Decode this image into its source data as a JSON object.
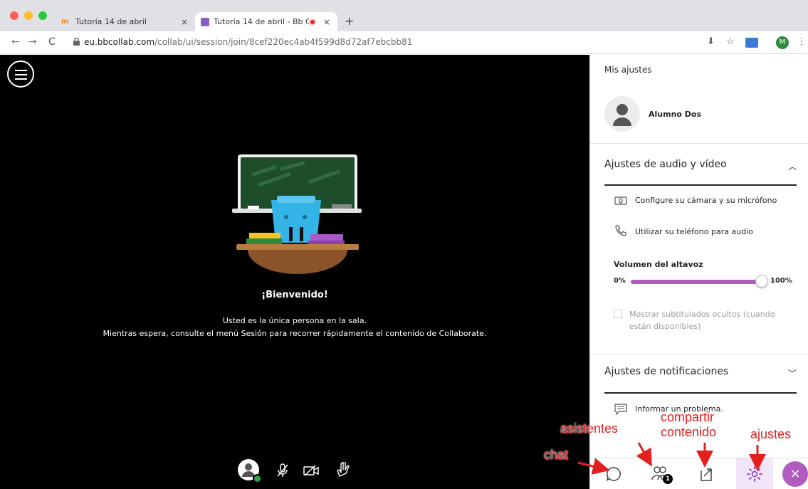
{
  "browser": {
    "tabs": [
      {
        "title": "Tutoría 14 de abril",
        "close": "×"
      },
      {
        "title": "Tutoría 14 de abril - Bb Col",
        "close": "×"
      }
    ],
    "new_tab": "+",
    "url_host": "eu.bbcollab.com",
    "url_path": "/collab/ui/session/join/8cef220ec4ab4f599d8d72af7ebcbb81",
    "profile_initial": "M",
    "colors": {
      "record": "#e5242c",
      "tab_bg": "#dfe1e5"
    }
  },
  "stage": {
    "welcome_title": "¡Bienvenido!",
    "message_line1": "Usted es la única persona en la sala.",
    "message_line2": "Mientras espera, consulte el menú Sesión para recorrer rápidamente el contenido de Collaborate."
  },
  "panel": {
    "title": "Mis ajustes",
    "user_name": "Alumno Dos",
    "audio_video": {
      "title": "Ajustes de audio y vídeo",
      "camera_mic": "Configure su cámara y su micrófono",
      "phone_audio": "Utilizar su teléfono para audio",
      "speaker_volume_label": "Volumen del altavoz",
      "volume_min": "0%",
      "volume_max": "100%",
      "volume_value": 1.0,
      "captions": "Mostrar subtitulados ocultos (cuando están disponibles)"
    },
    "notifications": {
      "title": "Ajustes de notificaciones",
      "report_problem": "Informar un problema."
    },
    "attendees_count": "1",
    "accent_color": "#b25cc2"
  },
  "annotations": {
    "chat": "chat",
    "attendees": "asistentes",
    "share_line1": "compartir",
    "share_line2": "contenido",
    "settings": "ajustes",
    "color": "#e32020"
  }
}
